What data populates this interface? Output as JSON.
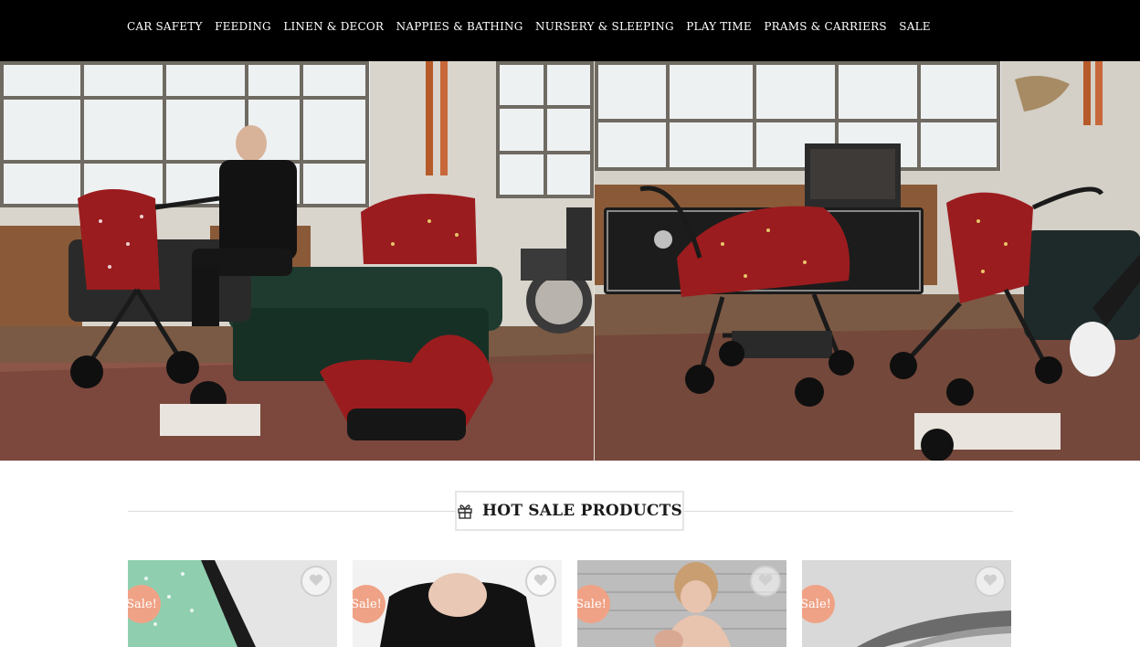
{
  "nav": {
    "items": [
      {
        "label": "CAR SAFETY"
      },
      {
        "label": "FEEDING"
      },
      {
        "label": "LINEN & DECOR"
      },
      {
        "label": "NAPPIES & BATHING"
      },
      {
        "label": "NURSERY & SLEEPING"
      },
      {
        "label": "PLAY TIME"
      },
      {
        "label": "PRAMS & CARRIERS"
      },
      {
        "label": "SALE"
      }
    ]
  },
  "hero": {
    "left_image": "stroller-loft-scene-photo",
    "right_image": "stroller-bassinet-scene-photo"
  },
  "section": {
    "title": "HOT SALE PRODUCTS",
    "icon": "gift-icon"
  },
  "products": [
    {
      "badge": "Sale!",
      "image": "stroller-seat-liner-photo",
      "wishlist_icon": "heart-icon"
    },
    {
      "badge": "Sale!",
      "image": "baby-carrier-photo",
      "wishlist_icon": "heart-icon"
    },
    {
      "badge": "Sale!",
      "image": "mother-and-baby-photo",
      "wishlist_icon": "heart-icon"
    },
    {
      "badge": "Sale!",
      "image": "pram-frame-photo",
      "wishlist_icon": "heart-icon"
    }
  ],
  "colors": {
    "nav_bg": "#000000",
    "nav_text": "#ffffff",
    "sale_badge": "#f0a286",
    "fabric_red": "#9b1c1e"
  }
}
